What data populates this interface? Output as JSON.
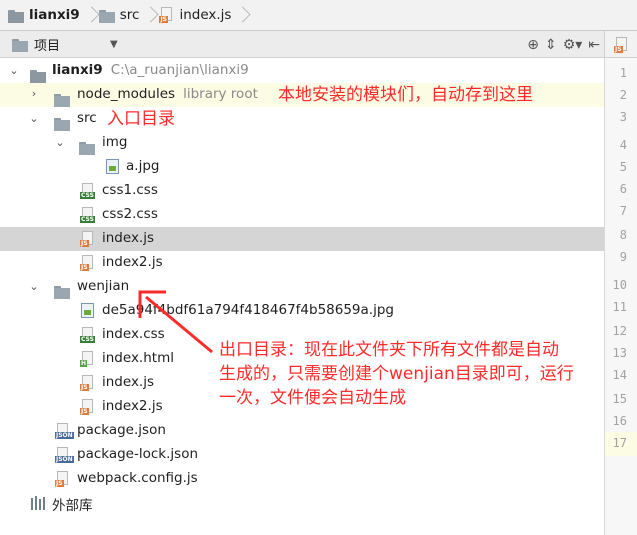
{
  "breadcrumbs": [
    {
      "label": "lianxi9",
      "icon": "folder-icon",
      "bold": true
    },
    {
      "label": "src",
      "icon": "folder-icon",
      "bold": false
    },
    {
      "label": "index.js",
      "icon": "js-file-icon",
      "bold": false
    }
  ],
  "toolbar": {
    "title": "项目",
    "icons": [
      "target-icon",
      "collapse-icon",
      "gear-icon",
      "hide-panel-icon"
    ]
  },
  "tree": {
    "root": {
      "name": "lianxi9",
      "path": "C:\\a_ruanjian\\lianxi9"
    },
    "node_modules": {
      "name": "node_modules",
      "note": "library root"
    },
    "src": "src",
    "img": "img",
    "a_jpg": "a.jpg",
    "css1": "css1.css",
    "css2": "css2.css",
    "index_js": "index.js",
    "index2_js": "index2.js",
    "wenjian": "wenjian",
    "w_img": "de5a94f4bdf61a794f418467f4b58659a.jpg",
    "w_css": "index.css",
    "w_html": "index.html",
    "w_js": "index.js",
    "w_js2": "index2.js",
    "package_json": "package.json",
    "package_lock": "package-lock.json",
    "webpack_config": "webpack.config.js",
    "external": "外部库"
  },
  "annotations": {
    "node_modules_note": "本地安装的模块们，自动存到这里",
    "src_note": "入口目录",
    "out_line1": "出口目录：现在此文件夹下所有文件都是自动",
    "out_line2": "生成的，只需要创建个wenjian目录即可，运行",
    "out_line3": "一次，文件便会自动生成"
  },
  "line_numbers": [
    "1",
    "2",
    "3",
    "4",
    "5",
    "6",
    "7",
    "8",
    "9",
    "10",
    "11",
    "12",
    "13",
    "14",
    "15",
    "16",
    "17"
  ],
  "colors": {
    "annotation": "#ff2b2b",
    "selected_row": "#d5d5d5",
    "highlight_row": "#fcfbe4"
  }
}
